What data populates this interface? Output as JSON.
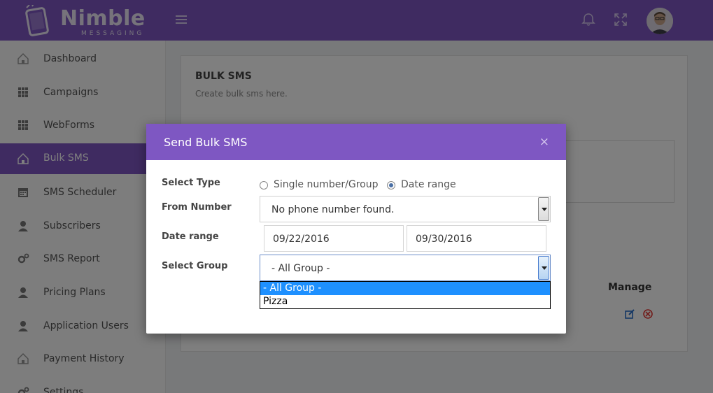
{
  "app": {
    "brand_name": "Nimble",
    "brand_sub": "MESSAGING"
  },
  "sidebar": {
    "items": [
      {
        "label": "Dashboard",
        "icon": "home-icon"
      },
      {
        "label": "Campaigns",
        "icon": "grid-icon"
      },
      {
        "label": "WebForms",
        "icon": "grid-icon"
      },
      {
        "label": "Bulk SMS",
        "icon": "home-icon",
        "active": true
      },
      {
        "label": "SMS Scheduler",
        "icon": "calendar-icon"
      },
      {
        "label": "Subscribers",
        "icon": "user-icon"
      },
      {
        "label": "SMS Report",
        "icon": "gears-icon"
      },
      {
        "label": "Pricing Plans",
        "icon": "user-icon"
      },
      {
        "label": "Application Users",
        "icon": "user-icon"
      },
      {
        "label": "Payment History",
        "icon": "home-icon"
      },
      {
        "label": "Settings",
        "icon": "gears-icon"
      }
    ]
  },
  "page": {
    "title": "BULK SMS",
    "subtitle": "Create bulk sms here.",
    "manage_header": "Manage"
  },
  "modal": {
    "title": "Send Bulk SMS",
    "close": "×",
    "select_type_label": "Select Type",
    "type_options": [
      "Single number/Group",
      "Date range"
    ],
    "selected_type": "Date range",
    "from_number_label": "From Number",
    "from_number_value": "No phone number found.",
    "date_range_label": "Date range",
    "date_from": "09/22/2016",
    "date_to": "09/30/2016",
    "select_group_label": "Select Group",
    "group_value": "- All Group -",
    "group_options": [
      "- All Group -",
      "Pizza"
    ]
  },
  "colors": {
    "brand": "#7e57c2",
    "highlight": "#1e90ff"
  }
}
